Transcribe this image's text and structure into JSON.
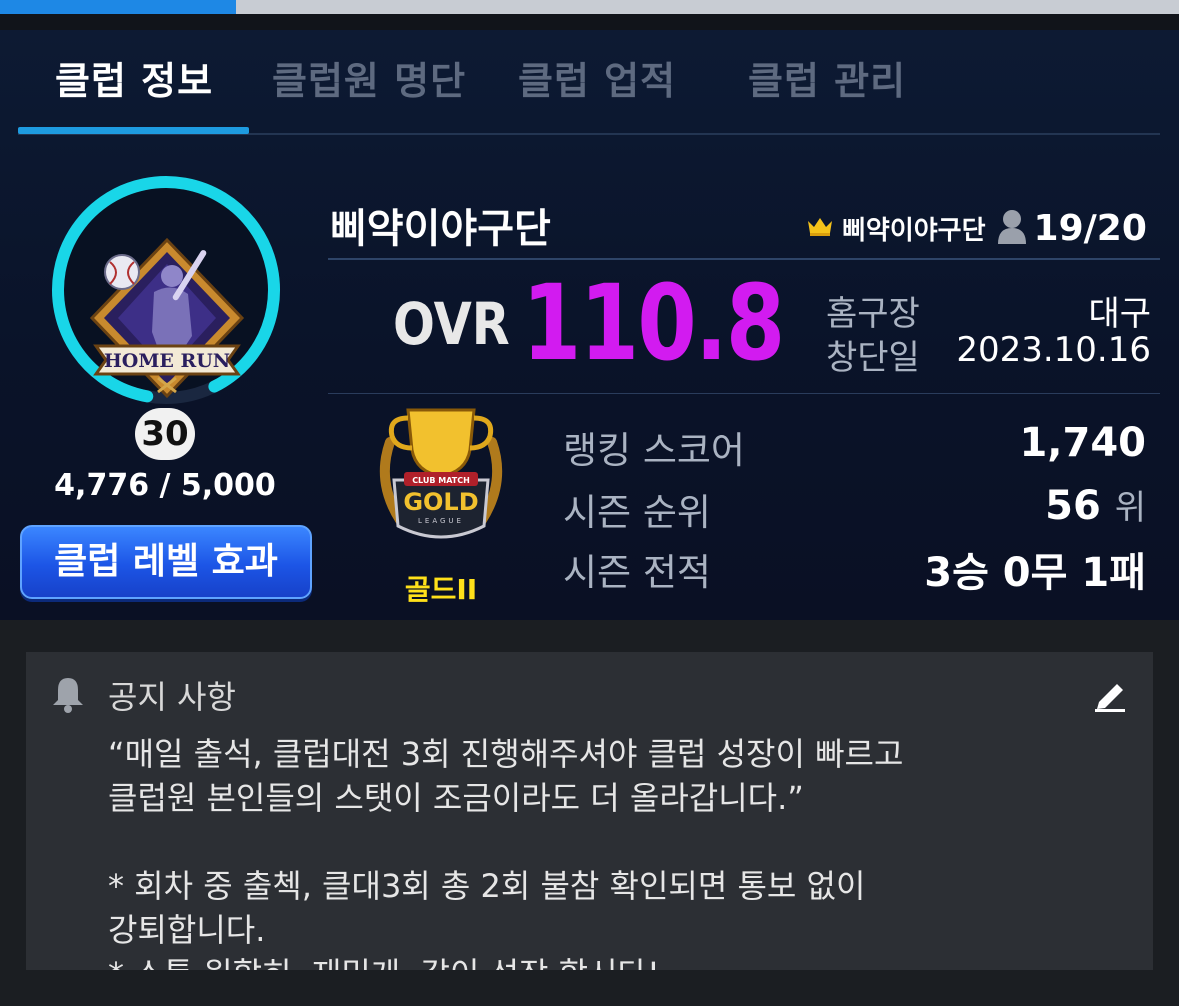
{
  "progress": {
    "fraction": 0.2
  },
  "tabs": [
    {
      "label": "클럽 정보",
      "active": true
    },
    {
      "label": "클럽원 명단",
      "active": false
    },
    {
      "label": "클럽 업적",
      "active": false
    },
    {
      "label": "클럽 관리",
      "active": false
    }
  ],
  "emblem": {
    "text": "HOME RUN",
    "icon": "baseball-batter-emblem"
  },
  "level": {
    "value": "30",
    "exp_text": "4,776 / 5,000",
    "exp_current": 4776,
    "exp_max": 5000,
    "button_label": "클럽 레벨 효과",
    "ring_color": "#19d6e8"
  },
  "club": {
    "name": "삐약이야구단",
    "owner_icon": "crown-icon",
    "owner_name": "삐약이야구단",
    "member_icon": "member-icon",
    "member_count": "19/20"
  },
  "ovr": {
    "label": "OVR",
    "value": "110.8",
    "color": "#d21bf0"
  },
  "meta": {
    "home_label": "홈구장",
    "home_value": "대구",
    "founded_label": "창단일",
    "founded_value": "2023.10.16"
  },
  "tier": {
    "trophy_icon": "gold-league-trophy-icon",
    "badge_top": "CLUB MATCH",
    "badge_main": "GOLD",
    "badge_sub": "LEAGUE",
    "name": "골드II",
    "color": "#ffe01a"
  },
  "stats": {
    "score_label": "랭킹 스코어",
    "score_value": "1,740",
    "rank_label": "시즌 순위",
    "rank_value": "56",
    "rank_suffix": "위",
    "record_label": "시즌 전적",
    "record_value": "3승 0무 1패"
  },
  "notice": {
    "icon": "bell-icon",
    "title": "공지 사항",
    "edit_icon": "pencil-icon",
    "body": "“매일 출석, 클럽대전 3회 진행해주셔야 클럽 성장이 빠르고\n클럽원 본인들의 스탯이 조금이라도 더 올라갑니다.”\n\n* 회차 중 출첵, 클대3회 총 2회 불참 확인되면 통보 없이\n강퇴합니다.\n* 소통 원할히, 재밌게, 같이 성장 합시다!"
  }
}
